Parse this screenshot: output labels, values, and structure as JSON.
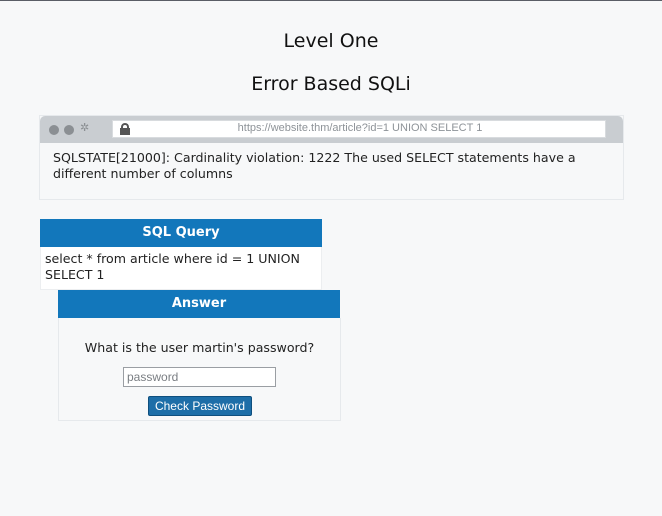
{
  "page": {
    "title": "Level One",
    "subtitle": "Error Based SQLi"
  },
  "browser": {
    "url": "https://website.thm/article?id=1 UNION SELECT 1",
    "error_message": "SQLSTATE[21000]: Cardinality violation: 1222 The used SELECT statements have a different number of columns"
  },
  "sql_query": {
    "header": "SQL Query",
    "query": "select * from article where id = 1 UNION SELECT 1"
  },
  "answer": {
    "header": "Answer",
    "question": "What is the user martin's password?",
    "password_placeholder": "password",
    "password_value": "",
    "button_label": "Check Password"
  },
  "colors": {
    "accent": "#1277bb",
    "button": "#1d6ea8",
    "background": "#f7f8f9"
  },
  "icons": [
    "lock-icon",
    "gear-icon",
    "window-dot-icon"
  ]
}
